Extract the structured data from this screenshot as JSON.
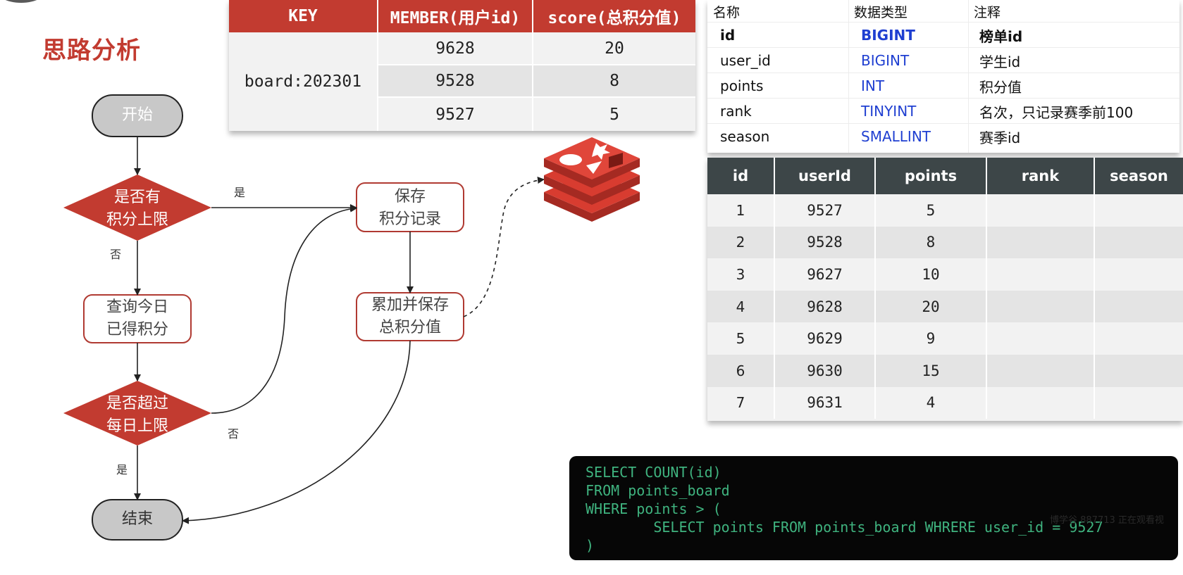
{
  "title": "思路分析",
  "flowchart": {
    "start": "开始",
    "decision_limit": "是否有\n积分上限",
    "save_record": "保存\n积分记录",
    "query_today": "查询今日\n已得积分",
    "accumulate": "累加并保存\n总积分值",
    "decision_exceed": "是否超过\n每日上限",
    "end": "结束",
    "label_yes_1": "是",
    "label_no_1": "否",
    "label_no_2": "否",
    "label_yes_2": "是"
  },
  "kv_table": {
    "headers": [
      "KEY",
      "MEMBER(用户id)",
      "score(总积分值)"
    ],
    "key": "board:202301",
    "rows": [
      {
        "member": "9628",
        "score": "20"
      },
      {
        "member": "9528",
        "score": "8"
      },
      {
        "member": "9527",
        "score": "5"
      }
    ]
  },
  "schema_table": {
    "headers": [
      "名称",
      "数据类型",
      "注释"
    ],
    "rows": [
      {
        "name": "id",
        "type": "BIGINT",
        "comment": "榜单id",
        "bold": true
      },
      {
        "name": "user_id",
        "type": "BIGINT",
        "comment": "学生id"
      },
      {
        "name": "points",
        "type": "INT",
        "comment": "积分值"
      },
      {
        "name": "rank",
        "type": "TINYINT",
        "comment": "名次，只记录赛季前100"
      },
      {
        "name": "season",
        "type": "SMALLINT",
        "comment": "赛季id"
      }
    ]
  },
  "data_table": {
    "headers": [
      "id",
      "userId",
      "points",
      "rank",
      "season"
    ],
    "rows": [
      [
        "1",
        "9527",
        "5",
        "",
        ""
      ],
      [
        "2",
        "9528",
        "8",
        "",
        ""
      ],
      [
        "3",
        "9627",
        "10",
        "",
        ""
      ],
      [
        "4",
        "9628",
        "20",
        "",
        ""
      ],
      [
        "5",
        "9629",
        "9",
        "",
        ""
      ],
      [
        "6",
        "9630",
        "15",
        "",
        ""
      ],
      [
        "7",
        "9631",
        "4",
        "",
        ""
      ]
    ]
  },
  "code": {
    "lines": [
      "SELECT COUNT(id)",
      "FROM points_board",
      "WHERE points > (",
      "        SELECT points FROM points_board WHRERE user_id = 9527",
      ")"
    ],
    "watermark": "博学谷 887713 正在观看视"
  },
  "colors": {
    "accent": "#c23b30",
    "table_header_dark": "#3d4648",
    "type_blue": "#1f3fd1",
    "code_green": "#3fb37f",
    "terminal_gray": "#c8c8c8"
  },
  "icons": {
    "redis_logo": "redis-logo-icon"
  }
}
